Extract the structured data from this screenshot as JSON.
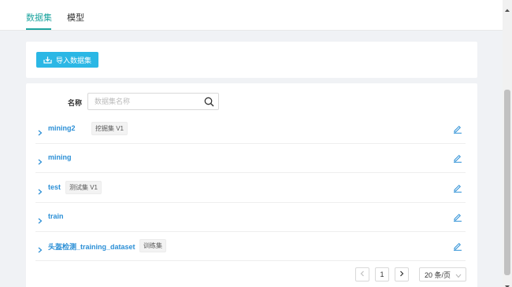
{
  "tabs": [
    {
      "label": "数据集",
      "active": true
    },
    {
      "label": "模型",
      "active": false
    }
  ],
  "toolbar": {
    "import_label": "导入数据集",
    "icon": "upload-icon"
  },
  "search": {
    "label": "名称",
    "placeholder": "数据集名称",
    "value": "",
    "icon": "search-icon"
  },
  "datasets": [
    {
      "name": "mining2",
      "tag": "挖掘集 V1"
    },
    {
      "name": "mining",
      "tag": ""
    },
    {
      "name": "test",
      "tag": "测试集 V1"
    },
    {
      "name": "train",
      "tag": ""
    },
    {
      "name": "头盔检测_training_dataset",
      "tag": "训练集"
    }
  ],
  "pagination": {
    "current_page": "1",
    "page_size": "20 条/页"
  },
  "colors": {
    "accent": "#1fa5a0",
    "primary_button": "#2bb7e5",
    "link": "#2b8fd6",
    "background": "#f0f2f5"
  }
}
